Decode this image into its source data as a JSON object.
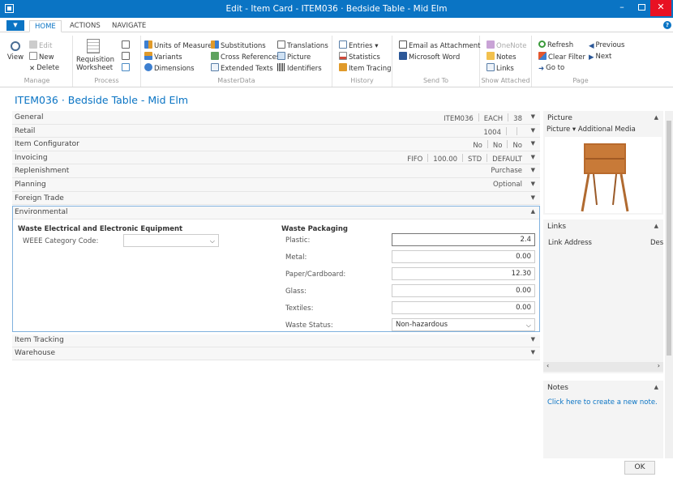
{
  "window": {
    "title": "Edit - Item Card - ITEM036 · Bedside Table - Mid Elm",
    "minimize": "–",
    "close": "✕"
  },
  "tabs": {
    "file": "▼",
    "home": "HOME",
    "actions": "ACTIONS",
    "navigate": "NAVIGATE",
    "help": "?"
  },
  "ribbon": {
    "manage": {
      "label": "Manage",
      "view": "View",
      "edit": "Edit",
      "new": "New",
      "delete": "Delete"
    },
    "process": {
      "label": "Process",
      "requisition": "Requisition Worksheet"
    },
    "masterdata": {
      "label": "MasterData",
      "units": "Units of Measure",
      "variants": "Variants",
      "dimensions": "Dimensions",
      "substitutions": "Substitutions",
      "cross_references": "Cross References",
      "extended_texts": "Extended Texts",
      "translations": "Translations",
      "picture": "Picture",
      "identifiers": "Identifiers"
    },
    "history": {
      "label": "History",
      "entries": "Entries ▾",
      "statistics": "Statistics",
      "item_tracing": "Item Tracing"
    },
    "sendto": {
      "label": "Send To",
      "email": "Email as Attachment",
      "word": "Microsoft Word"
    },
    "show_attached": {
      "label": "Show Attached",
      "onenote": "OneNote",
      "notes": "Notes",
      "links": "Links"
    },
    "page": {
      "label": "Page",
      "refresh": "Refresh",
      "clear_filter": "Clear Filter",
      "goto": "Go to",
      "previous": "Previous",
      "next": "Next"
    }
  },
  "page_title": "ITEM036 · Bedside Table - Mid Elm",
  "fasttabs": [
    {
      "name": "General",
      "values": [
        "ITEM036",
        "EACH",
        "38"
      ]
    },
    {
      "name": "Retail",
      "values": [
        "1004",
        "",
        ""
      ]
    },
    {
      "name": "Item Configurator",
      "values": [
        "No",
        "No",
        "No"
      ]
    },
    {
      "name": "Invoicing",
      "values": [
        "FIFO",
        "100.00",
        "STD",
        "DEFAULT"
      ]
    },
    {
      "name": "Replenishment",
      "values": [
        "Purchase"
      ]
    },
    {
      "name": "Planning",
      "values": [
        "Optional"
      ]
    },
    {
      "name": "Foreign Trade",
      "values": []
    }
  ],
  "environmental": {
    "name": "Environmental",
    "weee_heading": "Waste Electrical and Electronic Equipment",
    "weee_label": "WEEE Category Code:",
    "weee_value": "",
    "packaging_heading": "Waste Packaging",
    "fields": [
      {
        "label": "Plastic:",
        "value": "2.4"
      },
      {
        "label": "Metal:",
        "value": "0.00"
      },
      {
        "label": "Paper/Cardboard:",
        "value": "12.30"
      },
      {
        "label": "Glass:",
        "value": "0.00"
      },
      {
        "label": "Textiles:",
        "value": "0.00"
      }
    ],
    "status_label": "Waste Status:",
    "status_value": "Non-hazardous"
  },
  "after_tabs": [
    "Item Tracking",
    "Warehouse"
  ],
  "factbox": {
    "picture": {
      "title": "Picture",
      "picture_action": "Picture",
      "additional": "Additional Media"
    },
    "links": {
      "title": "Links",
      "col1": "Link Address",
      "col2": "Des"
    },
    "notes": {
      "title": "Notes",
      "create": "Click here to create a new note."
    }
  },
  "ok": "OK"
}
